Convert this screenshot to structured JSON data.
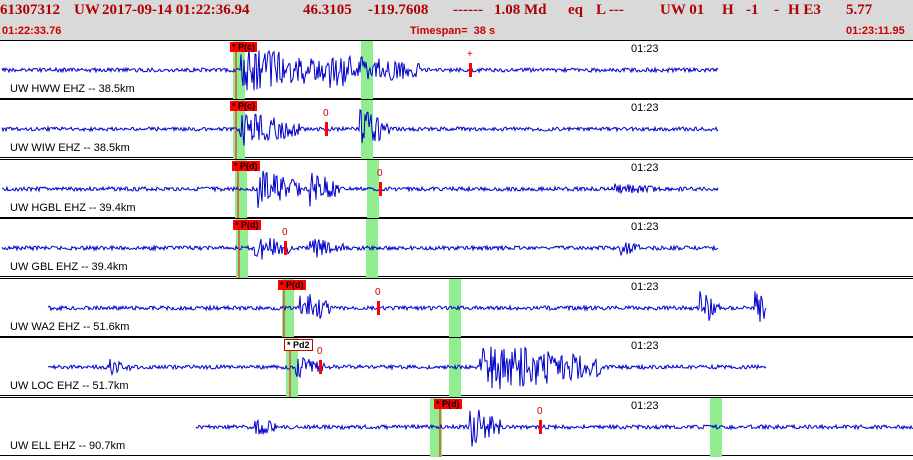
{
  "header": {
    "event_id": "61307312",
    "network": "UW",
    "datetime": "2017-09-14 01:22:36.94",
    "lat": "46.3105",
    "lon": "-119.7608",
    "dashes": "------",
    "magnitude": "1.08 Md",
    "event_type": "eq",
    "flag": "L ---",
    "author": "UW 01",
    "h_flag": "H",
    "h_val": "-1",
    "dash": "-",
    "quality": "H E3",
    "rms": "5.77",
    "tail": "-----",
    "start_time": "01:22:33.76",
    "timespan": "Timespan=  38 s",
    "end_time": "01:23:11.95"
  },
  "traces": [
    {
      "label": "UW HWW EHZ -- 38.5km",
      "time": "01:23",
      "pick": "* P(c)",
      "pick_style": "filled",
      "zero": "+"
    },
    {
      "label": "UW WIW EHZ -- 38.5km",
      "time": "01:23",
      "pick": "* P(c)",
      "pick_style": "filled",
      "zero": "0"
    },
    {
      "label": "UW HGBL EHZ -- 39.4km",
      "time": "01:23",
      "pick": "* P(d)",
      "pick_style": "filled",
      "zero": "0"
    },
    {
      "label": "UW GBL EHZ -- 39.4km",
      "time": "01:23",
      "pick": "* P(d)",
      "pick_style": "filled",
      "zero": "0"
    },
    {
      "label": "UW WA2 EHZ -- 51.6km",
      "time": "01:23",
      "pick": "* P(d)",
      "pick_style": "filled",
      "zero": "0"
    },
    {
      "label": "UW LOC EHZ -- 51.7km",
      "time": "01:23",
      "pick": "* Pd2",
      "pick_style": "outline",
      "zero": "0"
    },
    {
      "label": "UW ELL EHZ -- 90.7km",
      "time": "01:23",
      "pick": "* P(d)",
      "pick_style": "filled",
      "zero": "0"
    }
  ],
  "colors": {
    "header_bg": "#d9d9d9",
    "header_text": "#b00000",
    "trace": "#0000cc",
    "pick": "#ff0000",
    "window": "#90ee90"
  }
}
